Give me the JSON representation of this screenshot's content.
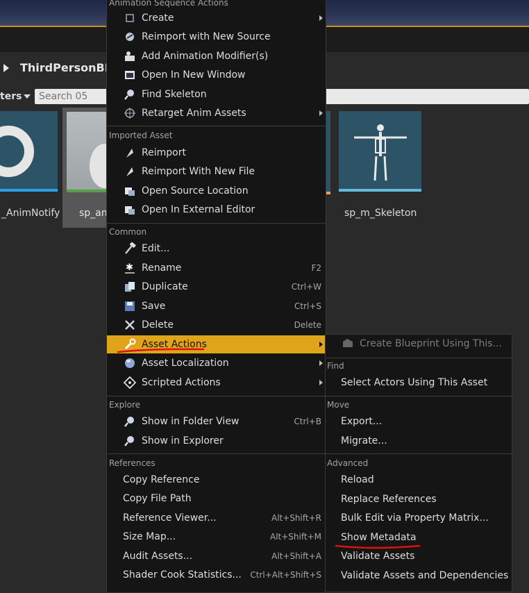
{
  "header": {
    "path": "ThirdPersonBP"
  },
  "toolbar": {
    "filters_label": "ters"
  },
  "search": {
    "placeholder": "Search 05"
  },
  "assets": {
    "animnotify": "_AnimNotify",
    "sp_anim": "sp_an",
    "skeleton": "sp_m_Skeleton"
  },
  "menu": {
    "title": "Animation Sequence Actions",
    "items": [
      {
        "label": "Create",
        "submenu": true,
        "icon": "create-icon"
      },
      {
        "label": "Reimport with New Source",
        "icon": "reimport-source-icon"
      },
      {
        "label": "Add Animation Modifier(s)",
        "icon": "modifier-icon"
      },
      {
        "label": "Open In New Window",
        "icon": "window-icon"
      },
      {
        "label": "Find Skeleton",
        "icon": "magnifier-icon"
      },
      {
        "label": "Retarget Anim Assets",
        "submenu": true,
        "icon": "crosshair-icon"
      }
    ],
    "sections": {
      "imported": "Imported Asset",
      "common": "Common",
      "explore": "Explore",
      "references": "References"
    },
    "imported_items": [
      {
        "label": "Reimport",
        "icon": "reimport-icon"
      },
      {
        "label": "Reimport With New File",
        "icon": "reimport-file-icon"
      },
      {
        "label": "Open Source Location",
        "icon": "folder-open-icon"
      },
      {
        "label": "Open In External Editor",
        "icon": "external-editor-icon"
      }
    ],
    "common_items": [
      {
        "label": "Edit...",
        "icon": "hammer-icon",
        "shortcut": ""
      },
      {
        "label": "Rename",
        "icon": "rename-icon",
        "shortcut": "F2"
      },
      {
        "label": "Duplicate",
        "icon": "duplicate-icon",
        "shortcut": "Ctrl+W"
      },
      {
        "label": "Save",
        "icon": "save-icon",
        "shortcut": "Ctrl+S"
      },
      {
        "label": "Delete",
        "icon": "delete-icon",
        "shortcut": "Delete"
      },
      {
        "label": "Asset Actions",
        "icon": "wrench-icon",
        "submenu": true
      },
      {
        "label": "Asset Localization",
        "icon": "globe-icon",
        "submenu": true
      },
      {
        "label": "Scripted Actions",
        "icon": "scripted-icon",
        "submenu": true
      }
    ],
    "explore_items": [
      {
        "label": "Show in Folder View",
        "icon": "magnifier-icon",
        "shortcut": "Ctrl+B"
      },
      {
        "label": "Show in Explorer",
        "icon": "magnifier-icon",
        "shortcut": ""
      }
    ],
    "reference_items": [
      {
        "label": "Copy Reference",
        "shortcut": ""
      },
      {
        "label": "Copy File Path",
        "shortcut": ""
      },
      {
        "label": "Reference Viewer...",
        "shortcut": "Alt+Shift+R"
      },
      {
        "label": "Size Map...",
        "shortcut": "Alt+Shift+M"
      },
      {
        "label": "Audit Assets...",
        "shortcut": "Alt+Shift+A"
      },
      {
        "label": "Shader Cook Statistics...",
        "shortcut": "Ctrl+Alt+Shift+S"
      }
    ]
  },
  "submenu": {
    "top_item": "Create Blueprint Using This...",
    "sections": {
      "find": "Find",
      "move": "Move",
      "advanced": "Advanced"
    },
    "find_items": [
      "Select Actors Using This Asset"
    ],
    "move_items": [
      "Export...",
      "Migrate..."
    ],
    "advanced_items": [
      "Reload",
      "Replace References",
      "Bulk Edit via Property Matrix...",
      "Show Metadata",
      "Validate Assets",
      "Validate Assets and Dependencies"
    ]
  },
  "colors": {
    "highlight": "#e0a41a",
    "annotation": "#e01010",
    "menu_bg": "#151515"
  }
}
